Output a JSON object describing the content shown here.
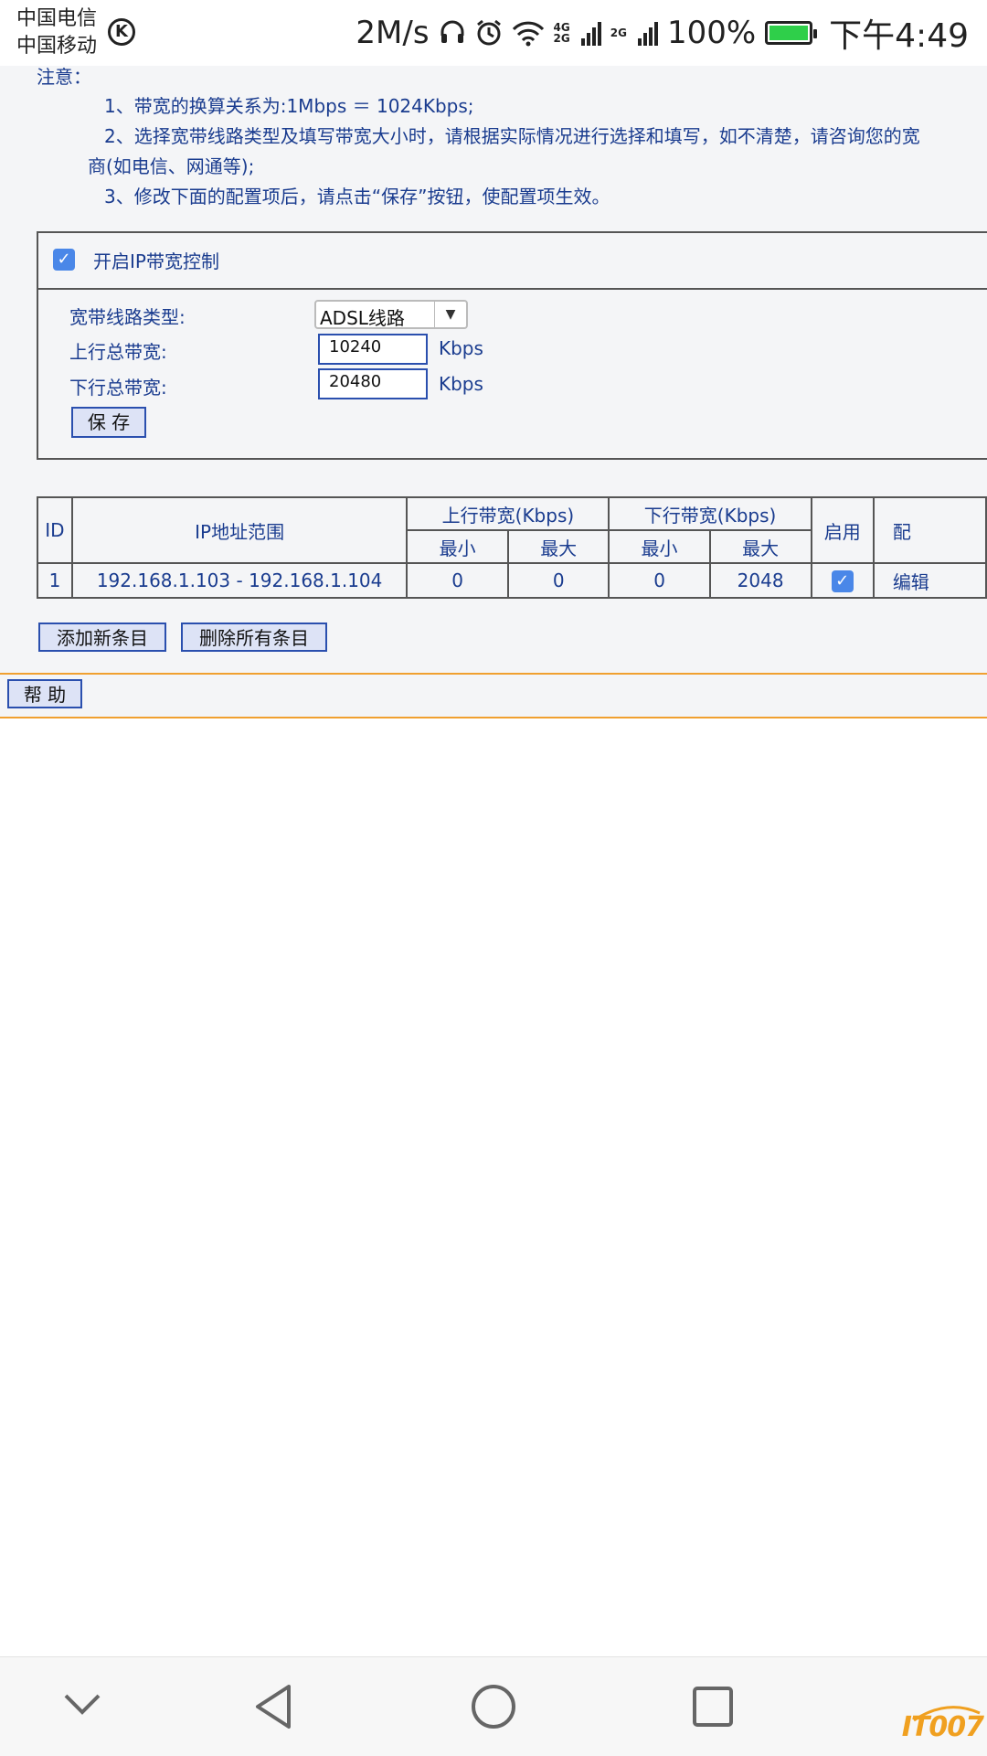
{
  "status_bar": {
    "carrier1": "中国电信",
    "carrier2": "中国移动",
    "k_badge": "K",
    "speed": "2M/s",
    "net1": [
      "4G",
      "2G"
    ],
    "net2": "2G",
    "battery": "100%",
    "time": "下午4:49"
  },
  "notes": {
    "title": "注意：",
    "line1": "1、带宽的换算关系为:1Mbps ＝ 1024Kbps;",
    "line2a": "2、选择宽带线路类型及填写带宽大小时，请根据实际情况进行选择和填写，如不清楚，请咨询您的宽",
    "line2b": "商(如电信、网通等);",
    "line3": "3、修改下面的配置项后，请点击“保存”按钮，使配置项生效。"
  },
  "ip_control": {
    "enable_label": "开启IP带宽控制",
    "line_type_label": "宽带线路类型:",
    "line_type_value": "ADSL线路",
    "up_label": "上行总带宽:",
    "up_value": "10240",
    "down_label": "下行总带宽:",
    "down_value": "20480",
    "unit": "Kbps",
    "save_label": "保 存"
  },
  "table": {
    "headers": {
      "id": "ID",
      "ip_range": "IP地址范围",
      "up": "上行带宽(Kbps)",
      "down": "下行带宽(Kbps)",
      "enabled": "启用",
      "config": "配",
      "min": "最小",
      "max": "最大"
    },
    "rows": [
      {
        "id": "1",
        "ip_range": "192.168.1.103 - 192.168.1.104",
        "up_min": "0",
        "up_max": "0",
        "down_min": "0",
        "down_max": "2048",
        "action": "编辑"
      }
    ]
  },
  "actions": {
    "add_label": "添加新条目",
    "delete_all_label": "删除所有条目",
    "help_label": "帮 助"
  },
  "watermark": "IT007"
}
